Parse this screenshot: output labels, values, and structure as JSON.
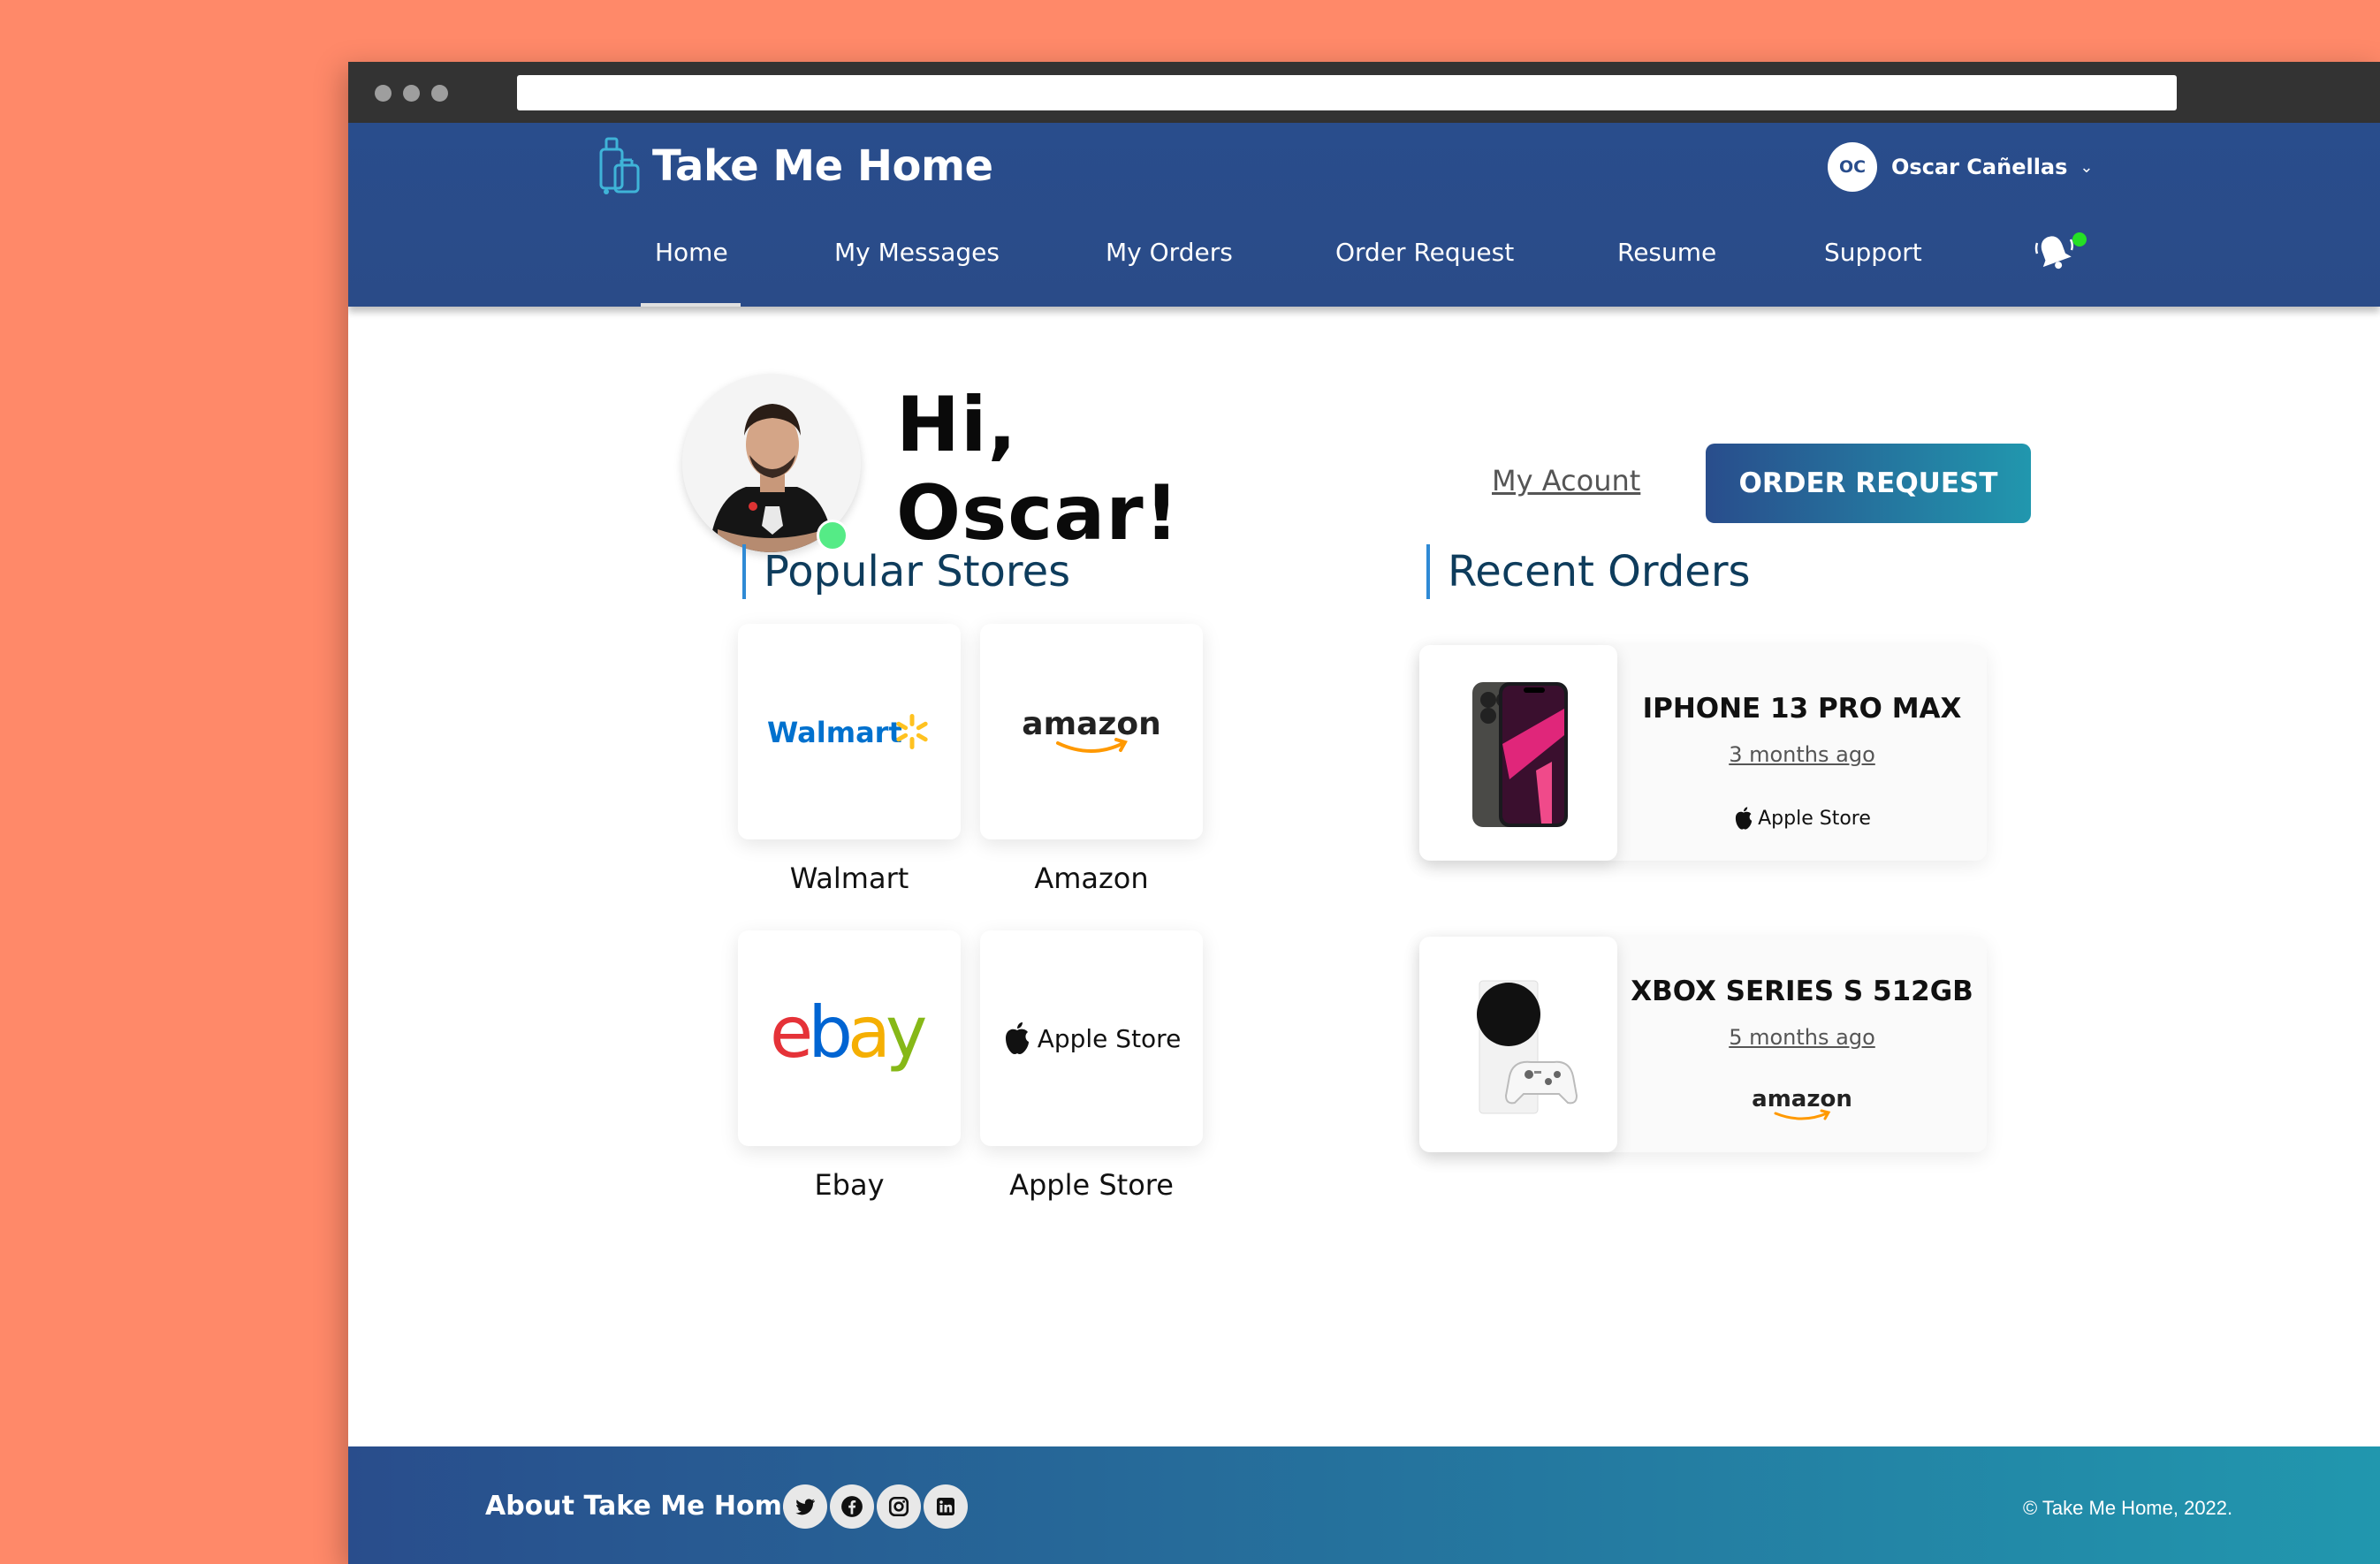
{
  "app": {
    "name": "Take Me Home"
  },
  "user": {
    "initials": "OC",
    "name": "Oscar Cañellas"
  },
  "nav": {
    "items": [
      {
        "label": "Home",
        "active": true
      },
      {
        "label": "My Messages"
      },
      {
        "label": "My Orders"
      },
      {
        "label": "Order Request"
      },
      {
        "label": "Resume"
      },
      {
        "label": "Support"
      }
    ]
  },
  "hero": {
    "greeting_line1": "Hi,",
    "greeting_line2": "Oscar!",
    "my_account_label": "My Acount",
    "order_request_label": "ORDER REQUEST"
  },
  "popular_stores": {
    "title": "Popular Stores",
    "stores": [
      {
        "label": "Walmart",
        "logo_text": "Walmart"
      },
      {
        "label": "Amazon",
        "logo_text": "amazon"
      },
      {
        "label": "Ebay",
        "logo_text": "ebay"
      },
      {
        "label": "Apple Store",
        "logo_text": "Apple Store"
      }
    ]
  },
  "recent_orders": {
    "title": "Recent Orders",
    "orders": [
      {
        "name": "IPHONE 13 PRO MAX",
        "time": "3 months ago",
        "store": "Apple Store",
        "store_icon": "apple-icon"
      },
      {
        "name": "XBOX SERIES S 512GB",
        "time": "5 months ago",
        "store": "amazon",
        "store_icon": "amazon-logo"
      }
    ]
  },
  "footer": {
    "about": "About Take Me Home",
    "socials": [
      "twitter-icon",
      "facebook-icon",
      "instagram-icon",
      "linkedin-icon"
    ],
    "copyright": "© Take Me Home, 2022."
  },
  "colors": {
    "background": "#FF8969",
    "header": "#294D8C",
    "accent": "#2197AE",
    "online": "#55EB86",
    "notification": "#25E025"
  }
}
